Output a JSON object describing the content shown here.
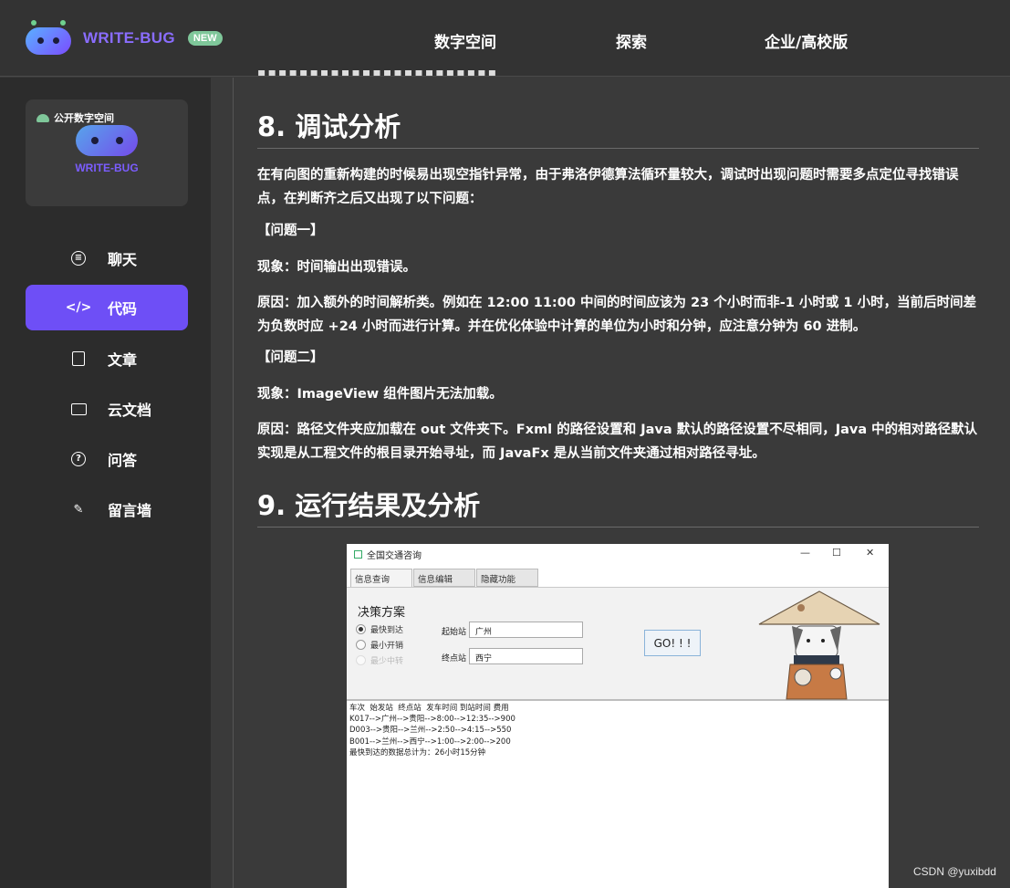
{
  "header": {
    "brand": "WRITE-BUG",
    "badge": "NEW",
    "nav": [
      "数字空间",
      "探索",
      "企业/高校版"
    ]
  },
  "sidebar": {
    "space_tag": "公开数字空间",
    "card_brand": "WRITE-BUG",
    "items": [
      {
        "label": "聊天",
        "icon": "chat-icon"
      },
      {
        "label": "代码",
        "icon": "code-icon",
        "active": true
      },
      {
        "label": "文章",
        "icon": "article-icon"
      },
      {
        "label": "云文档",
        "icon": "folder-icon"
      },
      {
        "label": "问答",
        "icon": "question-icon"
      },
      {
        "label": "留言墙",
        "icon": "edit-icon"
      }
    ]
  },
  "article": {
    "section8_title": "8. 调试分析",
    "p_intro": "在有向图的重新构建的时候易出现空指针异常，由于弗洛伊德算法循环量较大，调试时出现问题时需要多点定位寻找错误点，在判断齐之后又出现了以下问题：",
    "q1_title": "【问题一】",
    "q1_phenomenon": "现象：时间输出出现错误。",
    "q1_reason": "原因：加入额外的时间解析类。例如在 12:00 11:00 中间的时间应该为 23 个小时而非-1 小时或 1 小时，当前后时间差为负数时应 +24 小时而进行计算。并在优化体验中计算的单位为小时和分钟，应注意分钟为 60 进制。",
    "q2_title": "【问题二】",
    "q2_phenomenon": "现象：ImageView 组件图片无法加载。",
    "q2_reason": "原因：路径文件夹应加载在 out 文件夹下。Fxml 的路径设置和 Java 默认的路径设置不尽相同，Java 中的相对路径默认实现是从工程文件的根目录开始寻址，而 JavaFx 是从当前文件夹通过相对路径寻址。",
    "section9_title": "9. 运行结果及分析"
  },
  "app_window": {
    "title": "全国交通咨询",
    "controls": [
      "—",
      "☐",
      "✕"
    ],
    "tabs": [
      "信息查询",
      "信息编辑",
      "隐藏功能"
    ],
    "decision_title": "决策方案",
    "options": [
      {
        "label": "最快到达",
        "selected": true,
        "disabled": false
      },
      {
        "label": "最小开销",
        "selected": false,
        "disabled": false
      },
      {
        "label": "最少中转",
        "selected": false,
        "disabled": true
      }
    ],
    "start_label": "起始站",
    "start_value": "广州",
    "end_label": "终点站",
    "end_value": "西宁",
    "go_label": "GO! ! !",
    "result_lines": [
      "车次  始发站  终点站  发车时间 到站时间 费用",
      "K017-->广州-->贵阳-->8:00-->12:35-->900",
      "D003-->贵阳-->兰州-->2:50-->4:15-->550",
      "B001-->兰州-->西宁-->1:00-->2:00-->200",
      "最快到达的数据总计为：26小时15分钟"
    ]
  },
  "watermark": "CSDN @yuxibdd"
}
